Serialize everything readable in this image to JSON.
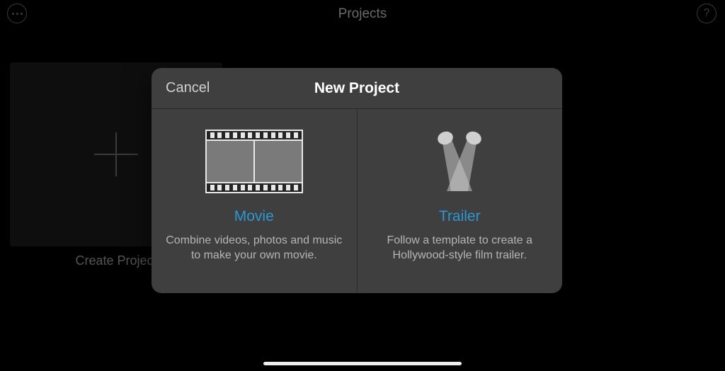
{
  "header": {
    "title": "Projects"
  },
  "background": {
    "create_label": "Create Project"
  },
  "modal": {
    "cancel_label": "Cancel",
    "title": "New Project",
    "options": {
      "movie": {
        "title": "Movie",
        "description": "Combine videos, photos and music to make your own movie."
      },
      "trailer": {
        "title": "Trailer",
        "description": "Follow a template to create a Hollywood-style film trailer."
      }
    }
  }
}
